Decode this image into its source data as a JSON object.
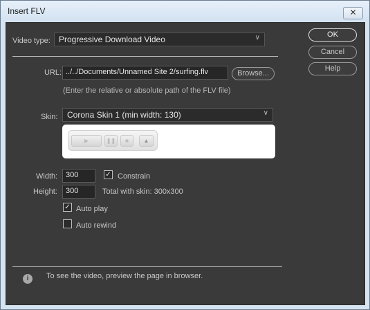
{
  "window": {
    "title": "Insert FLV",
    "close_label": "✕"
  },
  "video_type": {
    "label": "Video type:",
    "value": "Progressive Download Video"
  },
  "url": {
    "label": "URL:",
    "value": "../../Documents/Unnamed Site 2/surfing.flv",
    "browse_label": "Browse...",
    "hint": "(Enter the relative or absolute path of the FLV file)"
  },
  "skin": {
    "label": "Skin:",
    "value": "Corona Skin 1 (min width: 130)"
  },
  "width": {
    "label": "Width:",
    "value": "300"
  },
  "height": {
    "label": "Height:",
    "value": "300"
  },
  "constrain": {
    "label": "Constrain",
    "checked": true
  },
  "total_with_skin": "Total with skin: 300x300",
  "auto_play": {
    "label": "Auto play",
    "checked": true
  },
  "auto_rewind": {
    "label": "Auto rewind",
    "checked": false
  },
  "buttons": {
    "ok": "OK",
    "cancel": "Cancel",
    "help": "Help"
  },
  "footer_note": "To see the video, preview the page in browser.",
  "icons": {
    "close": "close-icon",
    "dropdown": "chevron-down-icon",
    "play": "play-icon",
    "pause": "pause-icon",
    "stop": "stop-icon",
    "volume": "volume-icon",
    "info": "info-icon"
  }
}
